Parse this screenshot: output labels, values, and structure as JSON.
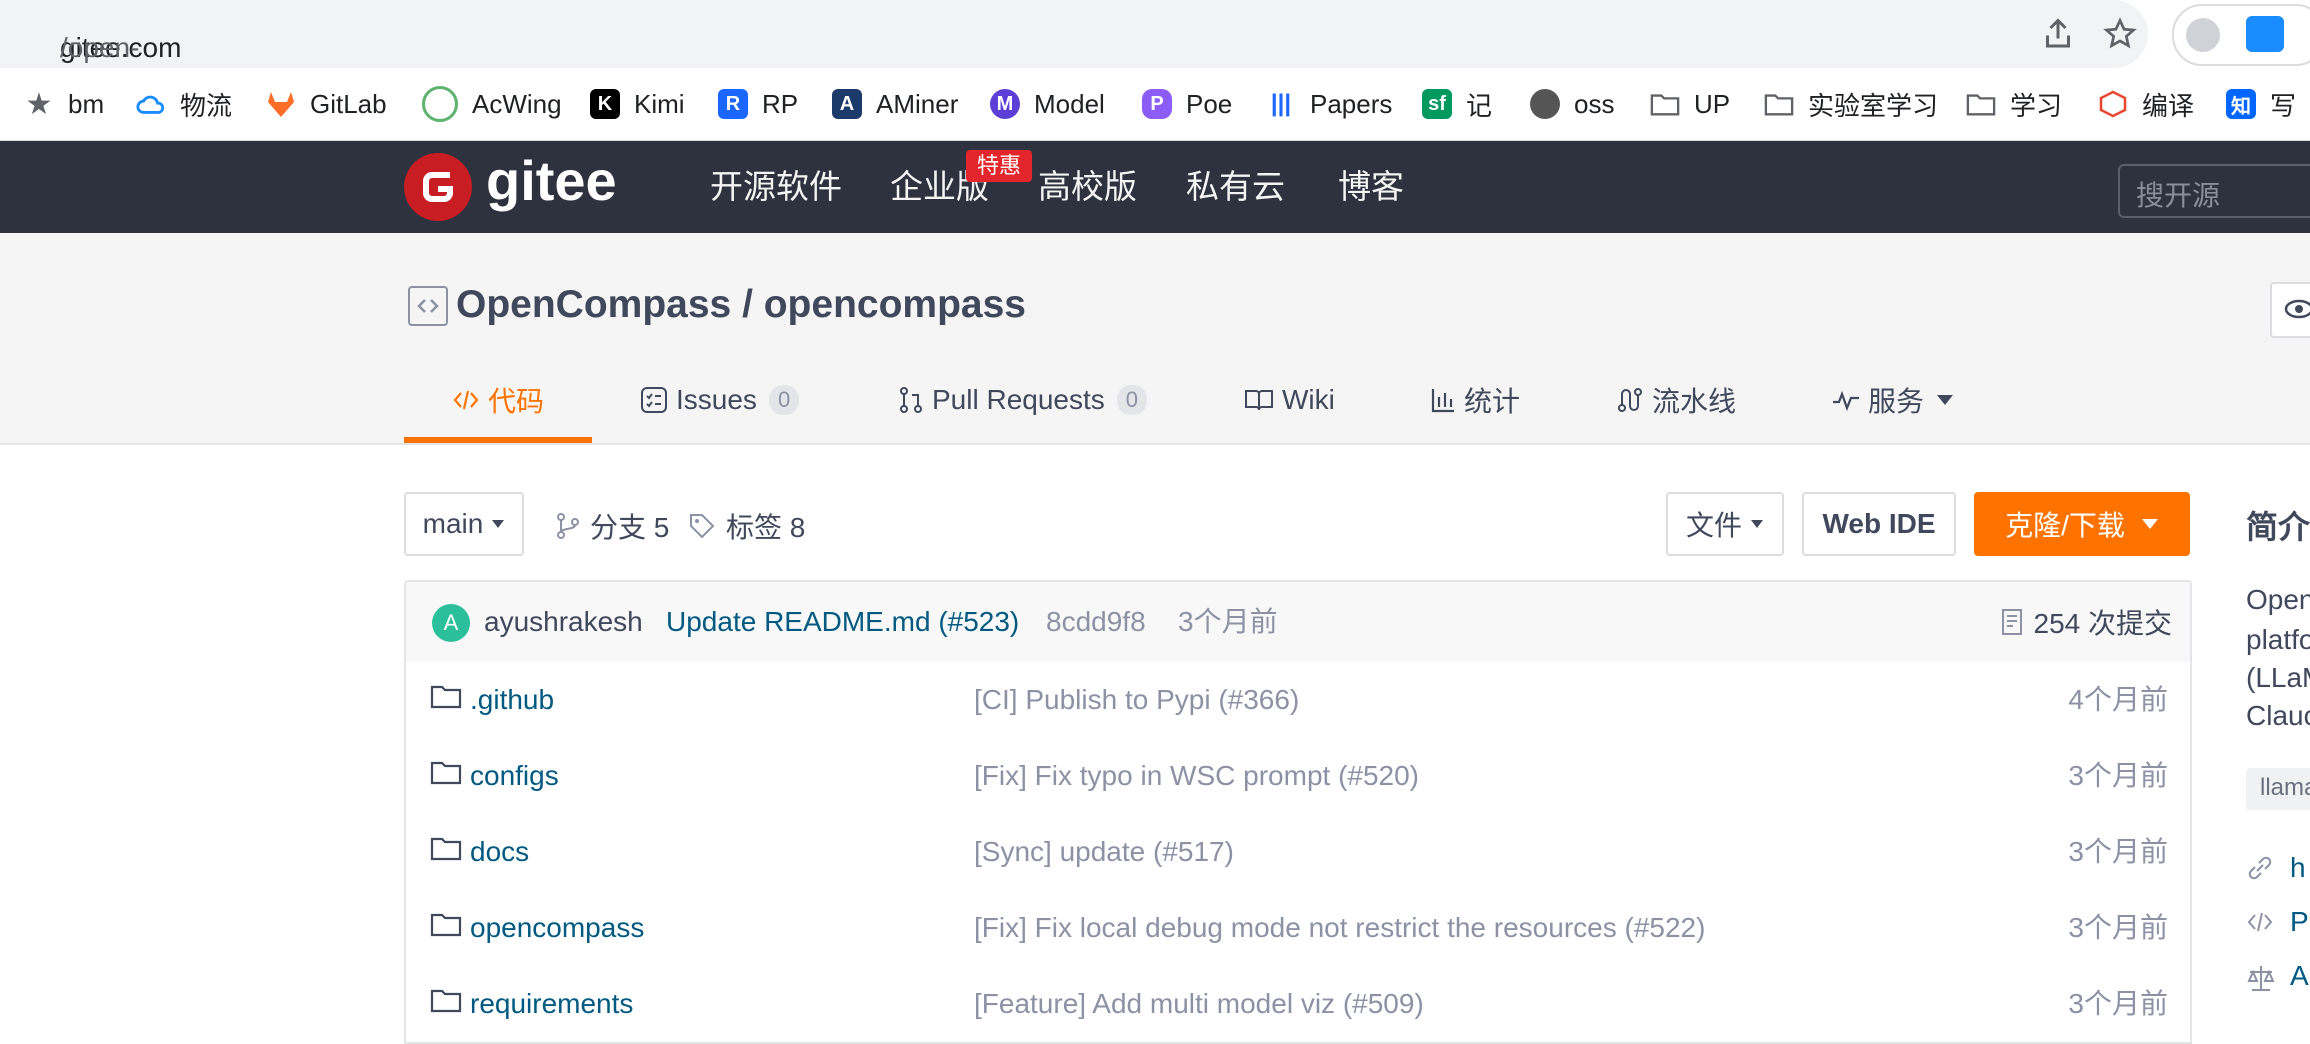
{
  "browser": {
    "url_host": "gitee.com",
    "url_path": "/open-compass/opencompass?_from=gitee_search"
  },
  "bookmarks": [
    {
      "label": "bm",
      "icon": "star-icon"
    },
    {
      "label": "物流",
      "icon": "cloud-icon"
    },
    {
      "label": "GitLab",
      "icon": "gitlab-icon"
    },
    {
      "label": "AcWing",
      "icon": "acwing-icon"
    },
    {
      "label": "Kimi",
      "icon": "kimi-icon"
    },
    {
      "label": "RP",
      "icon": "rp-icon"
    },
    {
      "label": "AMiner",
      "icon": "aminer-icon"
    },
    {
      "label": "Model",
      "icon": "model-icon"
    },
    {
      "label": "Poe",
      "icon": "poe-icon"
    },
    {
      "label": "Papers",
      "icon": "papers-icon"
    },
    {
      "label": "记",
      "icon": "sf-icon"
    },
    {
      "label": "oss",
      "icon": "globe-icon"
    },
    {
      "label": "UP",
      "icon": "folder-icon"
    },
    {
      "label": "实验室学习",
      "icon": "folder-icon"
    },
    {
      "label": "学习",
      "icon": "folder-icon"
    },
    {
      "label": "编译",
      "icon": "cube-icon"
    },
    {
      "label": "写",
      "icon": "zhihu-icon"
    }
  ],
  "nav": {
    "logo_text": "gitee",
    "items": [
      "开源软件",
      "企业版",
      "高校版",
      "私有云",
      "博客"
    ],
    "hot_badge": "特惠",
    "search_placeholder": "搜开源"
  },
  "project": {
    "title": "OpenCompass / opencompass",
    "tabs": [
      {
        "label": "代码",
        "count": ""
      },
      {
        "label": "Issues",
        "count": "0"
      },
      {
        "label": "Pull Requests",
        "count": "0"
      },
      {
        "label": "Wiki",
        "count": ""
      },
      {
        "label": "统计",
        "count": ""
      },
      {
        "label": "流水线",
        "count": ""
      },
      {
        "label": "服务",
        "count": ""
      }
    ]
  },
  "toolbar": {
    "branch": "main",
    "branches": "分支 5",
    "tags": "标签 8",
    "file_btn": "文件",
    "webide_btn": "Web IDE",
    "clone_btn": "克隆/下载"
  },
  "commit": {
    "avatar_letter": "A",
    "author": "ayushrakesh",
    "message": "Update README.md (#523)",
    "hash": "8cdd9f8",
    "time": "3个月前",
    "count": "254 次提交"
  },
  "files": [
    {
      "name": ".github",
      "msg": "[CI] Publish to Pypi (#366)",
      "time": "4个月前"
    },
    {
      "name": "configs",
      "msg": "[Fix] Fix typo in WSC prompt (#520)",
      "time": "3个月前"
    },
    {
      "name": "docs",
      "msg": "[Sync] update (#517)",
      "time": "3个月前"
    },
    {
      "name": "opencompass",
      "msg": "[Fix] Fix local debug mode not restrict the resources (#522)",
      "time": "3个月前"
    },
    {
      "name": "requirements",
      "msg": "[Feature] Add multi model viz (#509)",
      "time": "3个月前"
    }
  ],
  "sidebar": {
    "title": "简介",
    "desc_lines": [
      "Open",
      "platfo",
      "(LLaM",
      "Clauc"
    ],
    "tag": "llama",
    "links": [
      "h",
      "P",
      "A"
    ]
  },
  "colors": {
    "accent": "#fe7300",
    "nav_bg": "#2e323e",
    "link": "#005980",
    "logo_red": "#c71d23"
  }
}
